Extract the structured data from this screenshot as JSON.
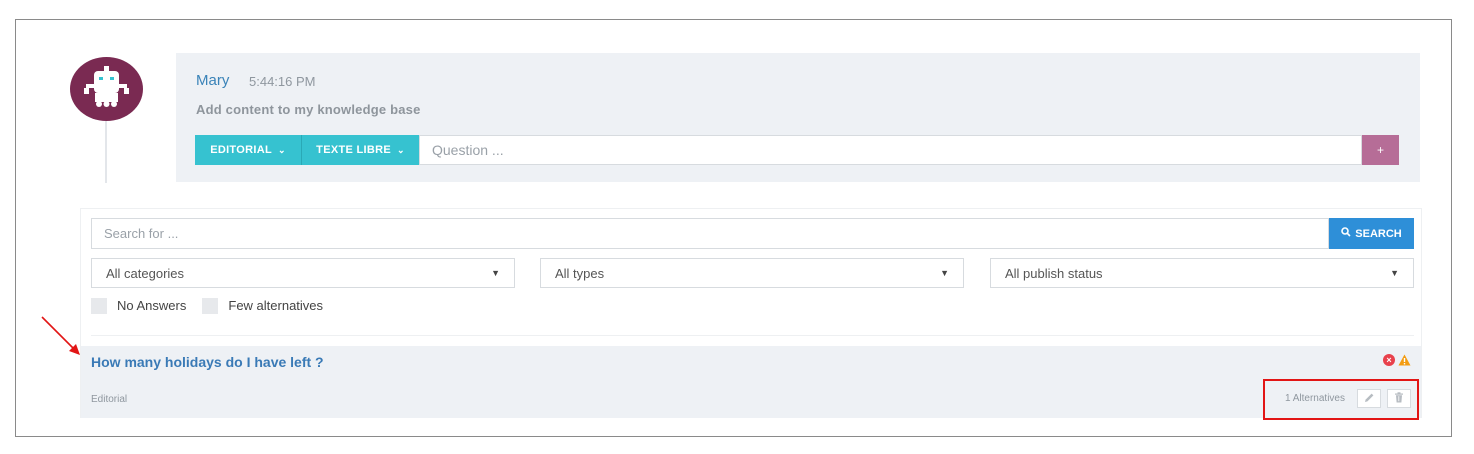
{
  "message": {
    "author": "Mary",
    "time": "5:44:16 PM",
    "text": "Add content to my knowledge base",
    "editorial_label": "EDITORIAL",
    "texte_libre_label": "TEXTE LIBRE",
    "question_placeholder": "Question ...",
    "add_label": "+"
  },
  "search": {
    "placeholder": "Search for ...",
    "button_label": "SEARCH",
    "categories": "All categories",
    "types": "All types",
    "publish_status": "All publish status",
    "filter_no_answers": "No Answers",
    "filter_few_alternatives": "Few alternatives"
  },
  "result": {
    "title": "How many holidays do I have left ?",
    "category": "Editorial",
    "alternatives": "1 Alternatives"
  },
  "colors": {
    "accent_teal": "#36c2d0",
    "accent_purple": "#b66d97",
    "search_blue": "#2e8fd8",
    "link_blue": "#3a7ab6",
    "error_red": "#e8414c",
    "warning_orange": "#f39c12",
    "annotation_red": "#e21515"
  },
  "icons": {
    "avatar": "robot-avatar-icon",
    "chevron": "chevron-down-icon",
    "search": "search-icon",
    "error": "error-circle-icon",
    "warning": "warning-triangle-icon",
    "edit": "pencil-icon",
    "delete": "trash-icon"
  }
}
